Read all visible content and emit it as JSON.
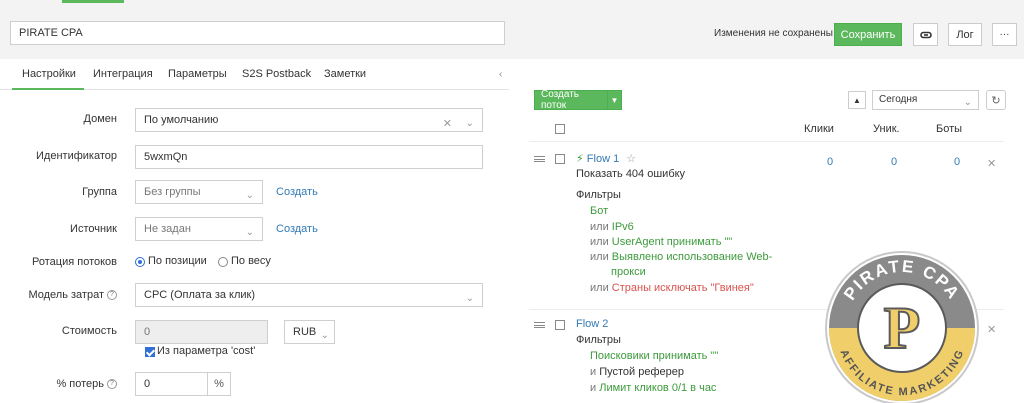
{
  "header": {
    "campaign_name": "PIRATE CPA",
    "unsaved_text": "Изменения не сохранены",
    "save_label": "Сохранить",
    "link_icon": "link-icon",
    "log_label": "Лог",
    "more_label": "···"
  },
  "tabs": [
    "Настройки",
    "Интеграция",
    "Параметры",
    "S2S Postback",
    "Заметки"
  ],
  "settings": {
    "domain_label": "Домен",
    "domain_value": "По умолчанию",
    "identifier_label": "Идентификатор",
    "identifier_value": "5wxmQn",
    "group_label": "Группа",
    "group_value": "Без группы",
    "group_create": "Создать",
    "source_label": "Источник",
    "source_value": "Не задан",
    "source_create": "Создать",
    "rotation_label": "Ротация потоков",
    "rotation_by_position": "По позиции",
    "rotation_by_weight": "По весу",
    "cost_model_label": "Модель затрат",
    "cost_model_value": "CPC (Оплата за клик)",
    "cost_label": "Стоимость",
    "cost_value": "0",
    "currency": "RUB",
    "from_param_label": "Из параметра 'cost'",
    "loss_label": "% потерь",
    "loss_value": "0",
    "loss_unit": "%"
  },
  "flows_panel": {
    "create_label": "Создать поток",
    "period_value": "Сегодня",
    "columns": [
      "Клики",
      "Уник.",
      "Боты"
    ],
    "flows": [
      {
        "name": "Flow 1",
        "action": "Показать 404 ошибку",
        "filters_title": "Фильтры",
        "filters": [
          {
            "conj": "",
            "text": "Бот",
            "color": "green"
          },
          {
            "conj": "или",
            "text": "IPv6",
            "color": "green"
          },
          {
            "conj": "или",
            "text": "UserAgent принимать \"\"",
            "color": "green"
          },
          {
            "conj": "или",
            "text": "Выявлено использование Web-",
            "color": "green"
          },
          {
            "conj": "",
            "text": "прокси",
            "color": "green"
          },
          {
            "conj": "или",
            "text": "Страны исключать \"Гвинея\"",
            "color": "red"
          }
        ],
        "clicks": "0",
        "unique": "0",
        "bots": "0"
      },
      {
        "name": "Flow 2",
        "filters_title": "Фильтры",
        "filters": [
          {
            "conj": "",
            "text": "Поисковики принимать \"\"",
            "color": "green"
          },
          {
            "conj": "и",
            "text": "Пустой реферер",
            "color": "dark"
          },
          {
            "conj": "и",
            "text": "Лимит кликов 0/1 в час",
            "color": "green"
          }
        ]
      }
    ]
  },
  "watermark": {
    "top_text": "PIRATE CPA",
    "bottom_text": "AFFILIATE MARKETING",
    "letter": "P"
  },
  "colors": {
    "accent_green": "#5cb85c",
    "link_blue": "#337ab7",
    "filter_green": "#3c9a3c",
    "filter_red": "#d9534f",
    "logo_yellow": "#f0cf6a"
  }
}
